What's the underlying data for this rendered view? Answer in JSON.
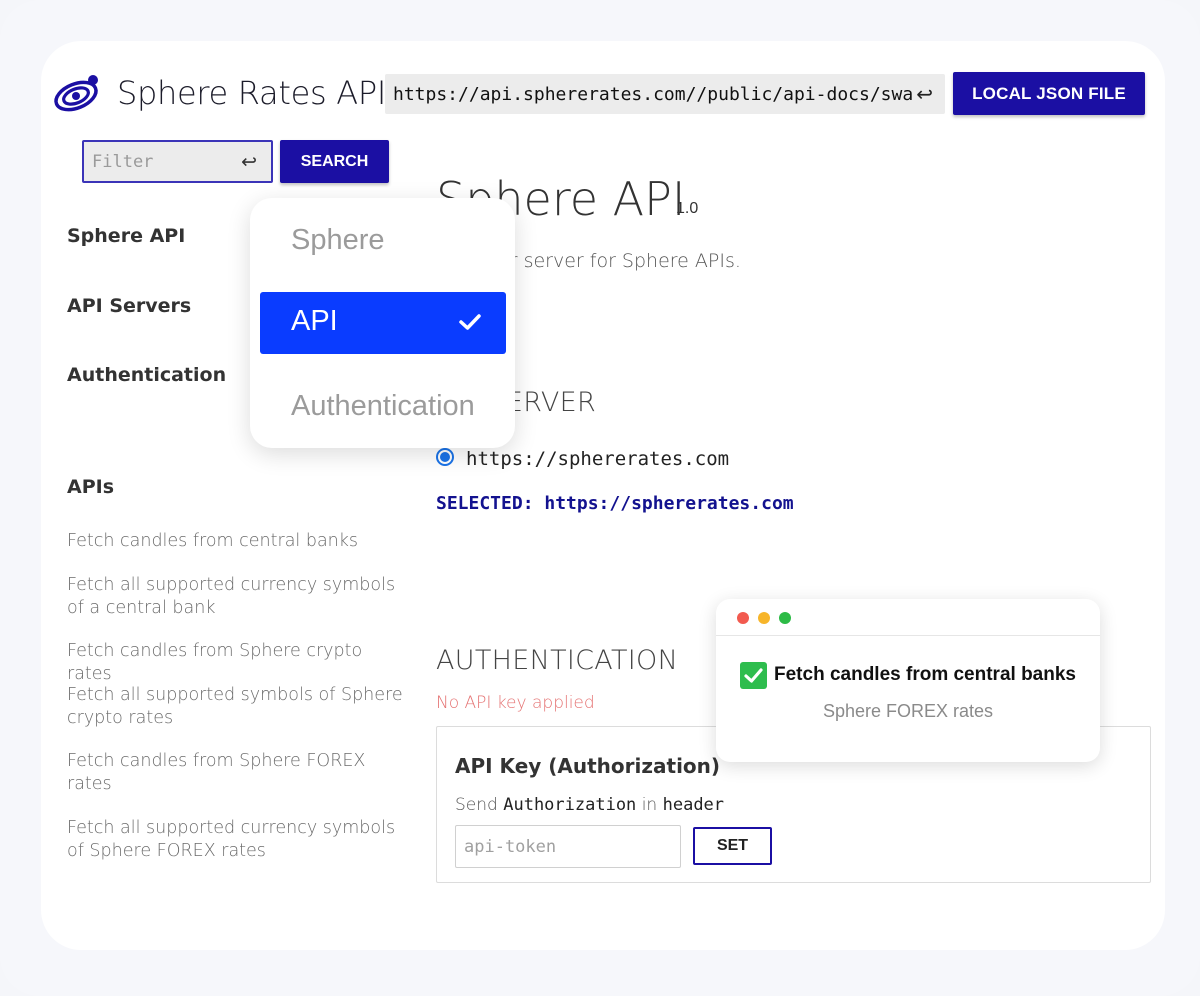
{
  "header": {
    "brand": "Sphere Rates API",
    "url_value": "https://api.sphererates.com//public/api-docs/swagger.json",
    "enter_glyph": "↩",
    "local_json_label": "LOCAL JSON FILE"
  },
  "sidebar": {
    "filter_placeholder": "Filter",
    "search_label": "SEARCH",
    "headings": [
      "Sphere API",
      "API Servers",
      "Authentication",
      "APIs"
    ],
    "links": [
      "Fetch candles from central banks",
      "Fetch all supported currency symbols of a central bank",
      "Fetch candles from Sphere crypto rates",
      "Fetch all supported symbols of Sphere crypto rates",
      "Fetch candles from Sphere FOREX rates",
      "Fetch all supported currency symbols of Sphere FOREX rates"
    ]
  },
  "main": {
    "title": "Sphere API",
    "version": "1.0",
    "subtitle": "Swagger server for Sphere APIs.",
    "server_heading": "API SERVER",
    "server_url": "https://sphererates.com",
    "selected_text": "SELECTED: https://sphererates.com",
    "auth_heading": "AUTHENTICATION",
    "no_key_text": "No API key applied",
    "auth_box": {
      "title": "API Key (Authorization)",
      "send_word": "Send",
      "send_key": "Authorization",
      "send_in": "in",
      "send_location": "header",
      "token_placeholder": "api-token",
      "set_label": "SET"
    }
  },
  "dropdown": {
    "items": [
      "Sphere",
      "API",
      "Authentication"
    ],
    "selected_index": 1,
    "selected_color": "#0a3cff"
  },
  "notification": {
    "title": "Fetch candles from central banks",
    "subtitle": "Sphere FOREX rates",
    "dots": [
      "#f25a4f",
      "#f7b52a",
      "#2dbb46"
    ]
  },
  "colors": {
    "primary_button": "#1b0fa3",
    "error_text": "#e57373",
    "radio": "#1a73e8"
  }
}
